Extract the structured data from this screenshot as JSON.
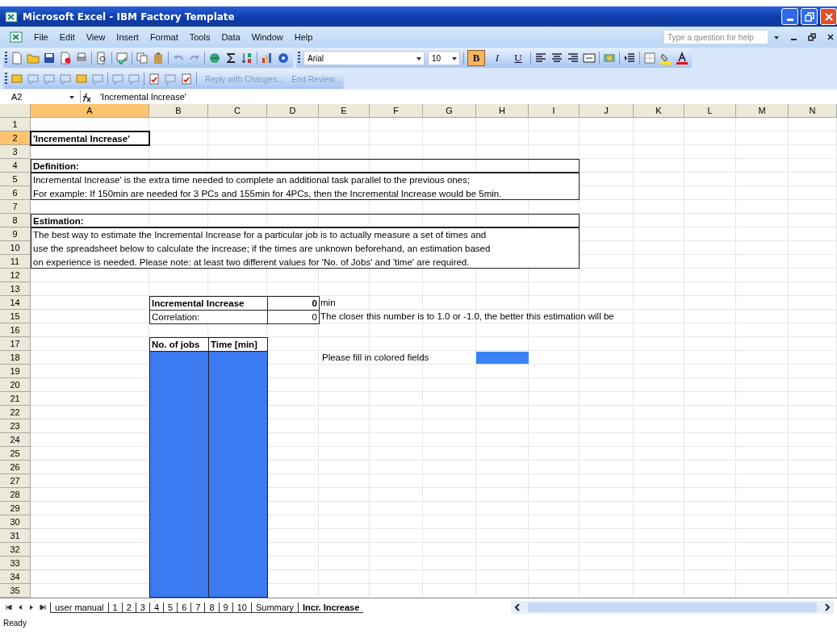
{
  "window": {
    "title": "Microsoft Excel - IBM Factory Template"
  },
  "menu": [
    "File",
    "Edit",
    "View",
    "Insert",
    "Format",
    "Tools",
    "Data",
    "Window",
    "Help"
  ],
  "help_box": {
    "placeholder": "Type a question for help"
  },
  "format_toolbar": {
    "font": "Arial",
    "size": "10",
    "styles": [
      {
        "label": "B",
        "selected": true
      },
      {
        "label": "I",
        "selected": false
      },
      {
        "label": "U",
        "selected": false
      }
    ]
  },
  "review_toolbar": {
    "commands": [
      {
        "label": "Reply with Changes...",
        "disabled": true
      },
      {
        "label": "End Review...",
        "disabled": true
      }
    ]
  },
  "formula_bar": {
    "name_box": "A2",
    "formula": "'Incremental Increase'"
  },
  "columns": [
    {
      "label": "A",
      "selected": true
    },
    {
      "label": "B",
      "selected": false
    },
    {
      "label": "C",
      "selected": false
    },
    {
      "label": "D",
      "selected": false
    },
    {
      "label": "E",
      "selected": false
    },
    {
      "label": "F",
      "selected": false
    },
    {
      "label": "G",
      "selected": false
    },
    {
      "label": "H",
      "selected": false
    },
    {
      "label": "I",
      "selected": false
    },
    {
      "label": "J",
      "selected": false
    },
    {
      "label": "K",
      "selected": false
    },
    {
      "label": "L",
      "selected": false
    },
    {
      "label": "M",
      "selected": false
    },
    {
      "label": "N",
      "selected": false
    }
  ],
  "rows": [
    {
      "label": "1",
      "selected": false
    },
    {
      "label": "2",
      "selected": true
    },
    {
      "label": "3",
      "selected": false
    },
    {
      "label": "4",
      "selected": false
    },
    {
      "label": "5",
      "selected": false
    },
    {
      "label": "6",
      "selected": false
    },
    {
      "label": "7",
      "selected": false
    },
    {
      "label": "8",
      "selected": false
    },
    {
      "label": "9",
      "selected": false
    },
    {
      "label": "10",
      "selected": false
    },
    {
      "label": "11",
      "selected": false
    },
    {
      "label": "12",
      "selected": false
    },
    {
      "label": "13",
      "selected": false
    },
    {
      "label": "14",
      "selected": false
    },
    {
      "label": "15",
      "selected": false
    },
    {
      "label": "16",
      "selected": false
    },
    {
      "label": "17",
      "selected": false
    },
    {
      "label": "18",
      "selected": false
    },
    {
      "label": "19",
      "selected": false
    },
    {
      "label": "20",
      "selected": false
    },
    {
      "label": "21",
      "selected": false
    },
    {
      "label": "22",
      "selected": false
    },
    {
      "label": "23",
      "selected": false
    },
    {
      "label": "24",
      "selected": false
    },
    {
      "label": "25",
      "selected": false
    },
    {
      "label": "26",
      "selected": false
    },
    {
      "label": "27",
      "selected": false
    },
    {
      "label": "28",
      "selected": false
    },
    {
      "label": "29",
      "selected": false
    },
    {
      "label": "30",
      "selected": false
    },
    {
      "label": "31",
      "selected": false
    },
    {
      "label": "32",
      "selected": false
    },
    {
      "label": "33",
      "selected": false
    },
    {
      "label": "34",
      "selected": false
    },
    {
      "label": "35",
      "selected": false
    }
  ],
  "sheet": {
    "title": "'Incremental Increase'",
    "definition": {
      "heading": "Definition:",
      "lines": [
        "Incremental Increase' is the extra time needed to complete an additional task parallel to the previous ones;",
        "For example: If 150min are needed for 3 PCs and 155min for 4PCs, then the Incremental Increase would be 5min."
      ]
    },
    "estimation": {
      "heading": "Estimation:",
      "lines": [
        "The best way to estimate the Incremental Increase for a particular job is to actually measure a set of times and",
        "use the spreadsheet below to calculate the increase; if the times are unknown beforehand, an estimation based",
        "on experience is needed. Please note: at least two different values for 'No. of Jobs' and 'time' are required."
      ]
    },
    "results": [
      {
        "label": "Incremental Increase",
        "value": "0",
        "note": "min",
        "bold": true
      },
      {
        "label": "Correlation:",
        "value": "0",
        "note": "The closer this number is to 1.0 or -1.0, the better this estimation will be",
        "bold": false
      }
    ],
    "input_table": {
      "columns": [
        "No. of jobs",
        "Time [min]"
      ]
    },
    "legend": "Please fill in colored fields"
  },
  "sheet_tabs": [
    {
      "label": "user manual",
      "selected": false
    },
    {
      "label": "1",
      "selected": false
    },
    {
      "label": "2",
      "selected": false
    },
    {
      "label": "3",
      "selected": false
    },
    {
      "label": "4",
      "selected": false
    },
    {
      "label": "5",
      "selected": false
    },
    {
      "label": "6",
      "selected": false
    },
    {
      "label": "7",
      "selected": false
    },
    {
      "label": "8",
      "selected": false
    },
    {
      "label": "9",
      "selected": false
    },
    {
      "label": "10",
      "selected": false
    },
    {
      "label": "Summary",
      "selected": false
    },
    {
      "label": "Incr. Increase",
      "selected": true
    }
  ],
  "status_bar": {
    "text": "Ready"
  }
}
